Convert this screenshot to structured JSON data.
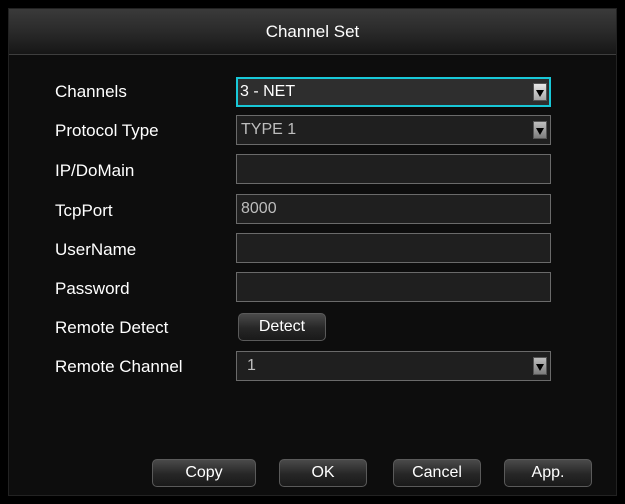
{
  "dialog": {
    "title": "Channel Set"
  },
  "labels": {
    "channels": "Channels",
    "protocol_type": "Protocol Type",
    "ip_domain": "IP/DoMain",
    "tcp_port": "TcpPort",
    "user_name": "UserName",
    "password": "Password",
    "remote_detect": "Remote Detect",
    "remote_channel": "Remote Channel"
  },
  "fields": {
    "channels": "3 - NET",
    "protocol_type": "TYPE 1",
    "ip_domain": "",
    "tcp_port": "8000",
    "user_name": "",
    "password": "",
    "remote_channel": "1"
  },
  "buttons": {
    "detect": "Detect",
    "copy": "Copy",
    "ok": "OK",
    "cancel": "Cancel",
    "apply": "App."
  },
  "colors": {
    "focus_border": "#18c8d8"
  }
}
